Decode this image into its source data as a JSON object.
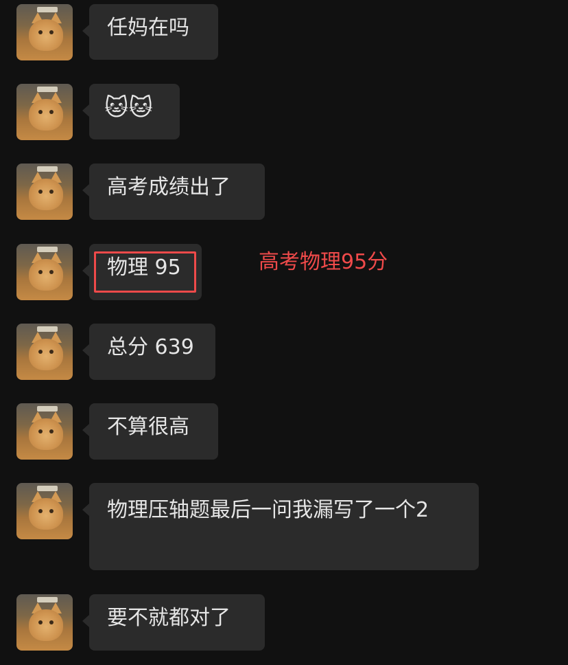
{
  "messages": [
    {
      "text": "任妈在吗"
    },
    {
      "text": "🐱🐱"
    },
    {
      "text": "高考成绩出了"
    },
    {
      "text": "物理 95"
    },
    {
      "text": "总分 639"
    },
    {
      "text": "不算很高"
    },
    {
      "text": "物理压轴题最后一问我漏写了一个2"
    },
    {
      "text": "要不就都对了"
    }
  ],
  "annotation": {
    "text": "高考物理95分",
    "color": "#ef4a4a"
  },
  "colors": {
    "background": "#111111",
    "bubble": "#2b2b2b",
    "text": "#e6e6e6",
    "highlight": "#ef4a4a"
  }
}
